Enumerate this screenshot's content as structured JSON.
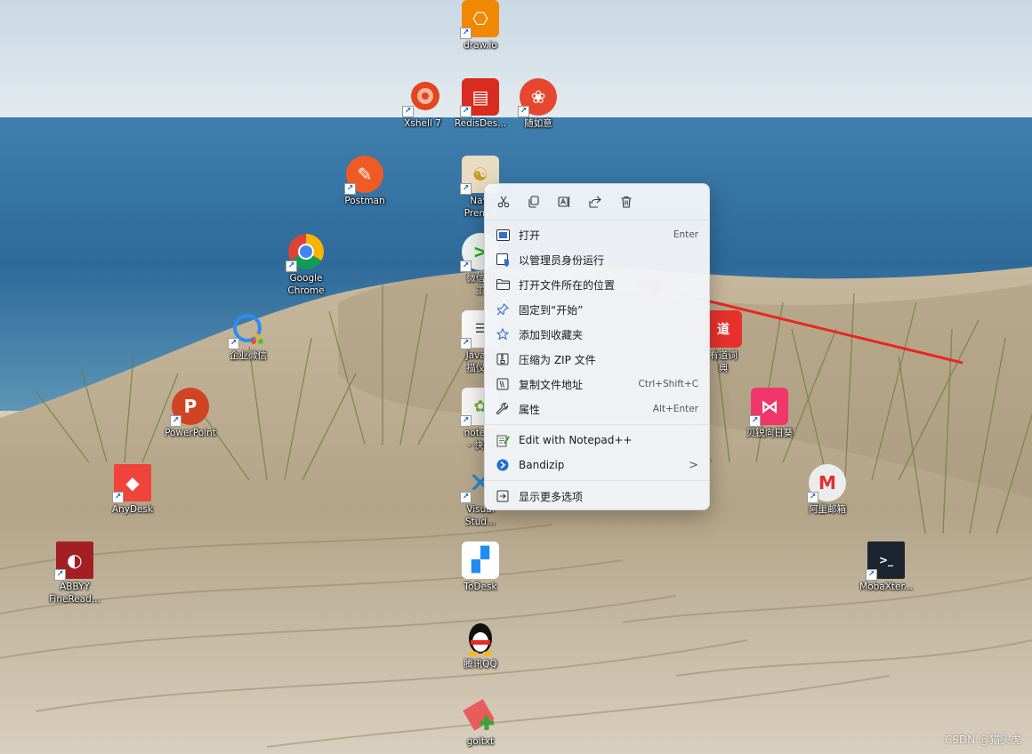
{
  "desktop": {
    "icons": [
      {
        "label": "draw.io"
      },
      {
        "label": "Xshell 7"
      },
      {
        "label": "RedisDes..."
      },
      {
        "label": "随如意"
      },
      {
        "label": "Postman"
      },
      {
        "label": "Navi\nPremiu"
      },
      {
        "label": "Google\nChrome"
      },
      {
        "label": "微信开\n工"
      },
      {
        "label": "企业微信"
      },
      {
        "label": "Java调\n描仪找"
      },
      {
        "label": "PowerPoint"
      },
      {
        "label": "notepa\n- 快捷"
      },
      {
        "label": "AnyDesk"
      },
      {
        "label": "Visual\nStud..."
      },
      {
        "label": "ABBYY\nFineRead..."
      },
      {
        "label": "ToDesk"
      },
      {
        "label": "腾讯QQ"
      },
      {
        "label": "goitxt"
      },
      {
        "label": "有道词\n典"
      },
      {
        "label": "贝锐向日葵"
      },
      {
        "label": "阿里邮箱"
      },
      {
        "label": "MobaXter..."
      }
    ]
  },
  "context_menu": {
    "toolbar": [
      "cut-icon",
      "copy-icon",
      "rename-icon",
      "share-icon",
      "delete-icon"
    ],
    "items": [
      {
        "label": "打开",
        "shortcut": "Enter"
      },
      {
        "label": "以管理员身份运行",
        "shortcut": ""
      },
      {
        "label": "打开文件所在的位置",
        "shortcut": ""
      },
      {
        "label": "固定到“开始”",
        "shortcut": ""
      },
      {
        "label": "添加到收藏夹",
        "shortcut": ""
      },
      {
        "label": "压缩为 ZIP 文件",
        "shortcut": ""
      },
      {
        "label": "复制文件地址",
        "shortcut": "Ctrl+Shift+C"
      },
      {
        "label": "属性",
        "shortcut": "Alt+Enter"
      },
      {
        "label": "Edit with Notepad++",
        "shortcut": ""
      },
      {
        "label": "Bandizip",
        "shortcut": "",
        "submenu": ">"
      },
      {
        "label": "显示更多选项",
        "shortcut": ""
      }
    ]
  },
  "colors": {
    "annotation_arrow": "#e8271f",
    "menu_bg": "#f2f4f7",
    "accent": "#0067c0"
  },
  "watermark": "CSDN @猫头虎"
}
